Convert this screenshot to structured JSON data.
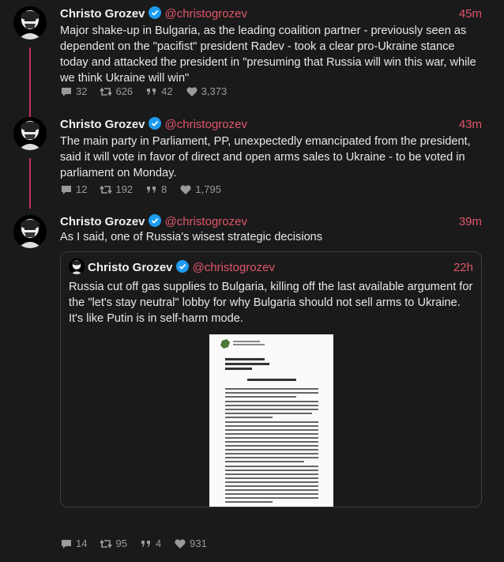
{
  "tweets": [
    {
      "name": "Christo Grozev",
      "handle": "@christogrozev",
      "time": "45m",
      "text": "Major shake-up in Bulgaria, as the leading coalition partner - previously seen as dependent on the \"pacifist\" president Radev - took a clear pro-Ukraine stance today and attacked the president in \"presuming that Russia will win this war, while we think Ukraine will win\"",
      "replies": "32",
      "retweets": "626",
      "quotes": "42",
      "likes": "3,373"
    },
    {
      "name": "Christo Grozev",
      "handle": "@christogrozev",
      "time": "43m",
      "text": "The main party in Parliament, PP, unexpectedly emancipated from the president, said it will vote in favor of direct and open arms sales to Ukraine - to be voted in parliament on Monday.",
      "replies": "12",
      "retweets": "192",
      "quotes": "8",
      "likes": "1,795"
    },
    {
      "name": "Christo Grozev",
      "handle": "@christogrozev",
      "time": "39m",
      "text": "As I said, one of Russia's wisest strategic decisions",
      "replies": "14",
      "retweets": "95",
      "quotes": "4",
      "likes": "931",
      "quoted": {
        "name": "Christo Grozev",
        "handle": "@christogrozev",
        "time": "22h",
        "text": "Russia cut off gas supplies to Bulgaria, killing off the last available argument for the \"let's stay neutral\" lobby for why Bulgaria should not sell arms to Ukraine. It's like Putin is in self-harm mode."
      }
    }
  ],
  "colors": {
    "accent": "#e0566a",
    "thread": "#c0305a",
    "verified": "#1d9bf0",
    "background": "#1a1a1a"
  },
  "icons": [
    "reply-icon",
    "retweet-icon",
    "quote-icon",
    "like-icon",
    "verified-icon"
  ]
}
